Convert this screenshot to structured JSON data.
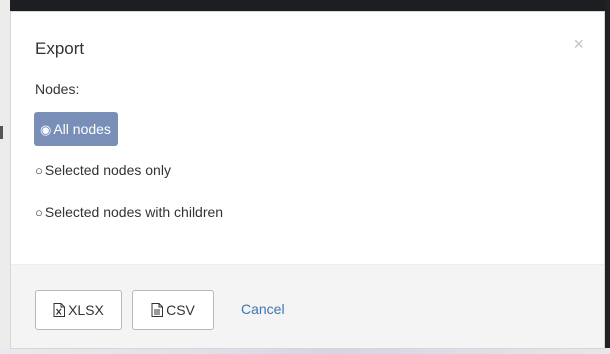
{
  "dialog": {
    "title": "Export",
    "close_glyph": "×",
    "nodes_label": "Nodes:"
  },
  "options": [
    {
      "label": "All nodes",
      "selected": true,
      "glyph": "◉"
    },
    {
      "label": "Selected nodes only",
      "selected": false,
      "glyph": "○"
    },
    {
      "label": "Selected nodes with children",
      "selected": false,
      "glyph": "○"
    }
  ],
  "footer": {
    "xlsx_label": "XLSX",
    "xlsx_icon": "excel-file-icon",
    "csv_label": "CSV",
    "csv_icon": "text-file-icon",
    "cancel_label": "Cancel"
  },
  "colors": {
    "selected_option_bg": "#7a8fb8",
    "link": "#3f74b8",
    "footer_bg": "#f4f4f4"
  }
}
